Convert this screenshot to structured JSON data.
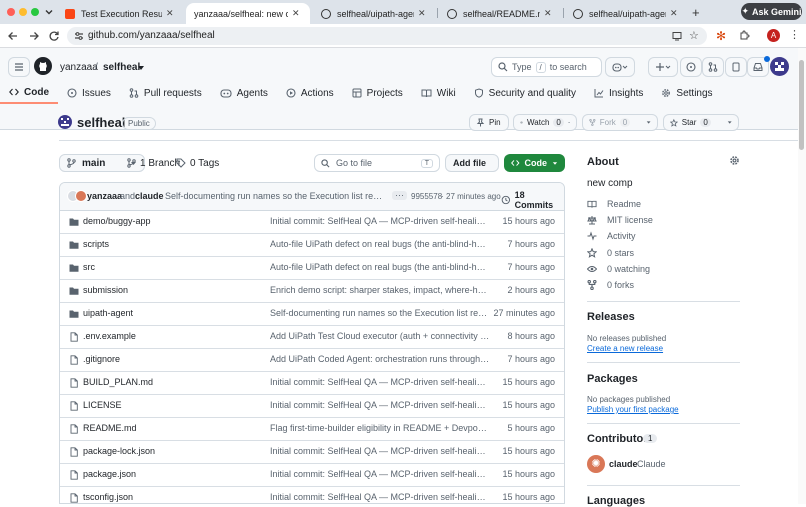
{
  "browser": {
    "tabs": [
      {
        "title": "Test Execution Results - Te",
        "fav": "uipath"
      },
      {
        "title": "yanzaaa/selfheal: new comp",
        "fav": "none"
      },
      {
        "title": "selfheal/uipath-agent at m",
        "fav": "github"
      },
      {
        "title": "selfheal/README.md at ma",
        "fav": "github"
      },
      {
        "title": "selfheal/uipath-agent/mai",
        "fav": "github"
      }
    ],
    "ask_gemini": "Ask Gemini",
    "url": "github.com/yanzaaa/selfheal",
    "avatar_letter": "A",
    "colors": {
      "tab_bar": "#dde3ea",
      "gemini": "#3c3f44",
      "avatar": "#c5221f"
    }
  },
  "header": {
    "owner": "yanzaaa",
    "separator": "/",
    "repo": "selfheal",
    "search_label": "Type",
    "search_key": "/",
    "search_suffix": "to search"
  },
  "repo_tabs": [
    {
      "label": "Code",
      "icon": "code-icon"
    },
    {
      "label": "Issues",
      "icon": "issue-icon"
    },
    {
      "label": "Pull requests",
      "icon": "pull-request-icon"
    },
    {
      "label": "Agents",
      "icon": "agents-icon"
    },
    {
      "label": "Actions",
      "icon": "play-icon"
    },
    {
      "label": "Projects",
      "icon": "table-icon"
    },
    {
      "label": "Wiki",
      "icon": "book-icon"
    },
    {
      "label": "Security and quality",
      "icon": "shield-icon"
    },
    {
      "label": "Insights",
      "icon": "graph-icon"
    },
    {
      "label": "Settings",
      "icon": "gear-icon"
    }
  ],
  "repo": {
    "name": "selfheal",
    "visibility": "Public",
    "pin": "Pin",
    "watch": "Watch",
    "watch_count": "0",
    "fork": "Fork",
    "fork_count": "0",
    "star": "Star",
    "star_count": "0"
  },
  "controls": {
    "branch": "main",
    "branches": "1 Branch",
    "tags": "0 Tags",
    "go_to_file": "Go to file",
    "go_key": "T",
    "add_file": "Add file",
    "code_button": "Code"
  },
  "commit": {
    "author1": "yanzaaa",
    "and": "and",
    "author2": "claude",
    "message": "Self-documenting run names so the Execution list reads lik...",
    "hash": "9955578",
    "dot": "·",
    "time": "27 minutes ago",
    "commits": "18 Commits"
  },
  "files": [
    {
      "name": "demo/buggy-app",
      "type": "dir",
      "message": "Initial commit: SelfHeal QA — MCP-driven self-healing test...",
      "age": "15 hours ago"
    },
    {
      "name": "scripts",
      "type": "dir",
      "message": "Auto-file UiPath defect on real bugs (the anti-blind-healin...",
      "age": "7 hours ago"
    },
    {
      "name": "src",
      "type": "dir",
      "message": "Auto-file UiPath defect on real bugs (the anti-blind-healin...",
      "age": "7 hours ago"
    },
    {
      "name": "submission",
      "type": "dir",
      "message": "Enrich demo script: sharper stakes, impact, where-human...",
      "age": "2 hours ago"
    },
    {
      "name": "uipath-agent",
      "type": "dir",
      "message": "Self-documenting run names so the Execution list reads lik...",
      "age": "27 minutes ago"
    },
    {
      "name": ".env.example",
      "type": "file",
      "message": "Add UiPath Test Cloud executor (auth + connectivity + res...",
      "age": "8 hours ago"
    },
    {
      "name": ".gitignore",
      "type": "file",
      "message": "Add UiPath Coded Agent: orchestration runs through the ...",
      "age": "7 hours ago"
    },
    {
      "name": "BUILD_PLAN.md",
      "type": "file",
      "message": "Initial commit: SelfHeal QA — MCP-driven self-healing test...",
      "age": "15 hours ago"
    },
    {
      "name": "LICENSE",
      "type": "file",
      "message": "Initial commit: SelfHeal QA — MCP-driven self-healing test...",
      "age": "15 hours ago"
    },
    {
      "name": "README.md",
      "type": "file",
      "message": "Flag first-time-builder eligibility in README + Devpost des...",
      "age": "5 hours ago"
    },
    {
      "name": "package-lock.json",
      "type": "file",
      "message": "Initial commit: SelfHeal QA — MCP-driven self-healing test...",
      "age": "15 hours ago"
    },
    {
      "name": "package.json",
      "type": "file",
      "message": "Initial commit: SelfHeal QA — MCP-driven self-healing test...",
      "age": "15 hours ago"
    },
    {
      "name": "tsconfig.json",
      "type": "file",
      "message": "Initial commit: SelfHeal QA — MCP-driven self-healing test...",
      "age": "15 hours ago"
    }
  ],
  "about": {
    "title": "About",
    "description": "new comp",
    "items": [
      {
        "label": "Readme",
        "icon": "book-icon"
      },
      {
        "label": "MIT license",
        "icon": "scale-icon"
      },
      {
        "label": "Activity",
        "icon": "pulse-icon"
      },
      {
        "label": "0 stars",
        "icon": "star-icon"
      },
      {
        "label": "0 watching",
        "icon": "eye-icon"
      },
      {
        "label": "0 forks",
        "icon": "fork-icon"
      }
    ]
  },
  "releases": {
    "title": "Releases",
    "note": "No releases published",
    "link": "Create a new release"
  },
  "packages": {
    "title": "Packages",
    "note": "No packages published",
    "link": "Publish your first package"
  },
  "contributors": {
    "title": "Contributors",
    "count": "1",
    "user": "claude",
    "name": "Claude"
  },
  "languages": {
    "title": "Languages"
  }
}
